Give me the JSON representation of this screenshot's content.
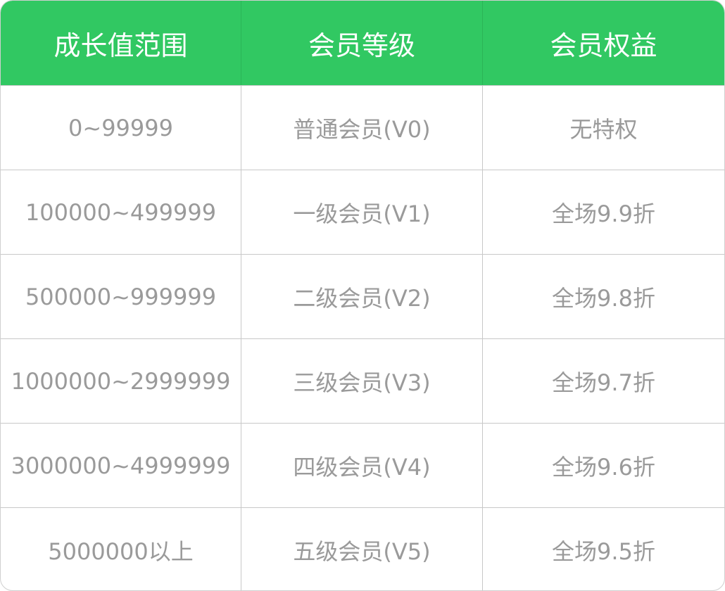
{
  "colors": {
    "header_bg": "#31c862",
    "header_text": "#ffffff",
    "cell_text": "#9a9a9a",
    "grid": "#c8c8c8"
  },
  "table": {
    "headers": [
      "成长值范围",
      "会员等级",
      "会员权益"
    ],
    "rows": [
      [
        "0~99999",
        "普通会员(V0)",
        "无特权"
      ],
      [
        "100000~499999",
        "一级会员(V1)",
        "全场9.9折"
      ],
      [
        "500000~999999",
        "二级会员(V2)",
        "全场9.8折"
      ],
      [
        "1000000~2999999",
        "三级会员(V3)",
        "全场9.7折"
      ],
      [
        "3000000~4999999",
        "四级会员(V4)",
        "全场9.6折"
      ],
      [
        "5000000以上",
        "五级会员(V5)",
        "全场9.5折"
      ]
    ]
  }
}
